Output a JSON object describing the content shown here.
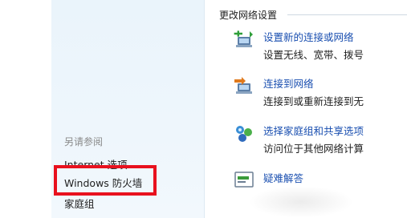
{
  "sidebar": {
    "see_also_label": "另请参阅",
    "links": [
      "Internet 选项",
      "Windows 防火墙",
      "家庭组"
    ],
    "highlight_color": "#e8111e"
  },
  "main": {
    "section_title": "更改网络设置",
    "tasks": [
      {
        "title": "设置新的连接或网络",
        "desc": "设置无线、宽带、拨号",
        "icon": "new-connection-icon"
      },
      {
        "title": "连接到网络",
        "desc": "连接到或重新连接到无",
        "icon": "connect-network-icon"
      },
      {
        "title": "选择家庭组和共享选项",
        "desc": "访问位于其他网络计算",
        "icon": "homegroup-icon"
      },
      {
        "title": "疑难解答",
        "desc": "",
        "icon": "troubleshoot-icon"
      }
    ],
    "link_color": "#1a4fb0"
  }
}
